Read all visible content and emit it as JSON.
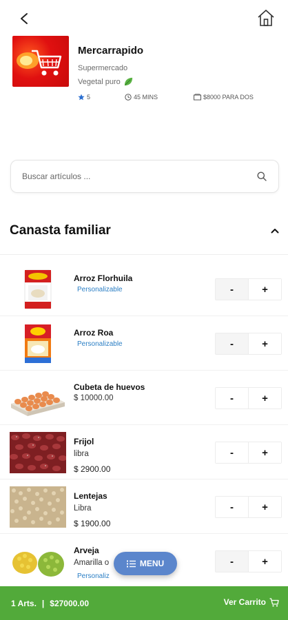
{
  "store": {
    "name": "Mercarrapido",
    "type": "Supermercado",
    "tag": "Vegetal puro",
    "rating": "5",
    "time": "45 MINS",
    "price_for_two": "$8000 PARA DOS"
  },
  "search": {
    "placeholder": "Buscar artículos ..."
  },
  "section": {
    "title": "Canasta familiar"
  },
  "products": [
    {
      "name": "Arroz Florhuila",
      "custom": "Personalizable",
      "minus": "-",
      "plus": "+"
    },
    {
      "name": "Arroz Roa",
      "custom": "Personalizable",
      "minus": "-",
      "plus": "+"
    },
    {
      "name": "Cubeta de huevos",
      "price": "$ 10000.00",
      "minus": "-",
      "plus": "+"
    },
    {
      "name": "Frijol",
      "unit": "libra",
      "price": "$ 2900.00",
      "minus": "-",
      "plus": "+"
    },
    {
      "name": "Lentejas",
      "unit": "Libra",
      "price": "$ 1900.00",
      "minus": "-",
      "plus": "+"
    },
    {
      "name": "Arveja",
      "unit": "Amarilla o",
      "custom": "Personaliz",
      "minus": "-",
      "plus": "+"
    }
  ],
  "fab": {
    "label": "MENU"
  },
  "cart": {
    "items": "1 Arts.",
    "separator": "|",
    "total": "$27000.00",
    "action": "Ver Carrito"
  },
  "colors": {
    "cart_bar": "#52aa3a",
    "fab": "#5b86cc",
    "link_blue": "#2a7ec4",
    "logo_red": "#d81212"
  }
}
